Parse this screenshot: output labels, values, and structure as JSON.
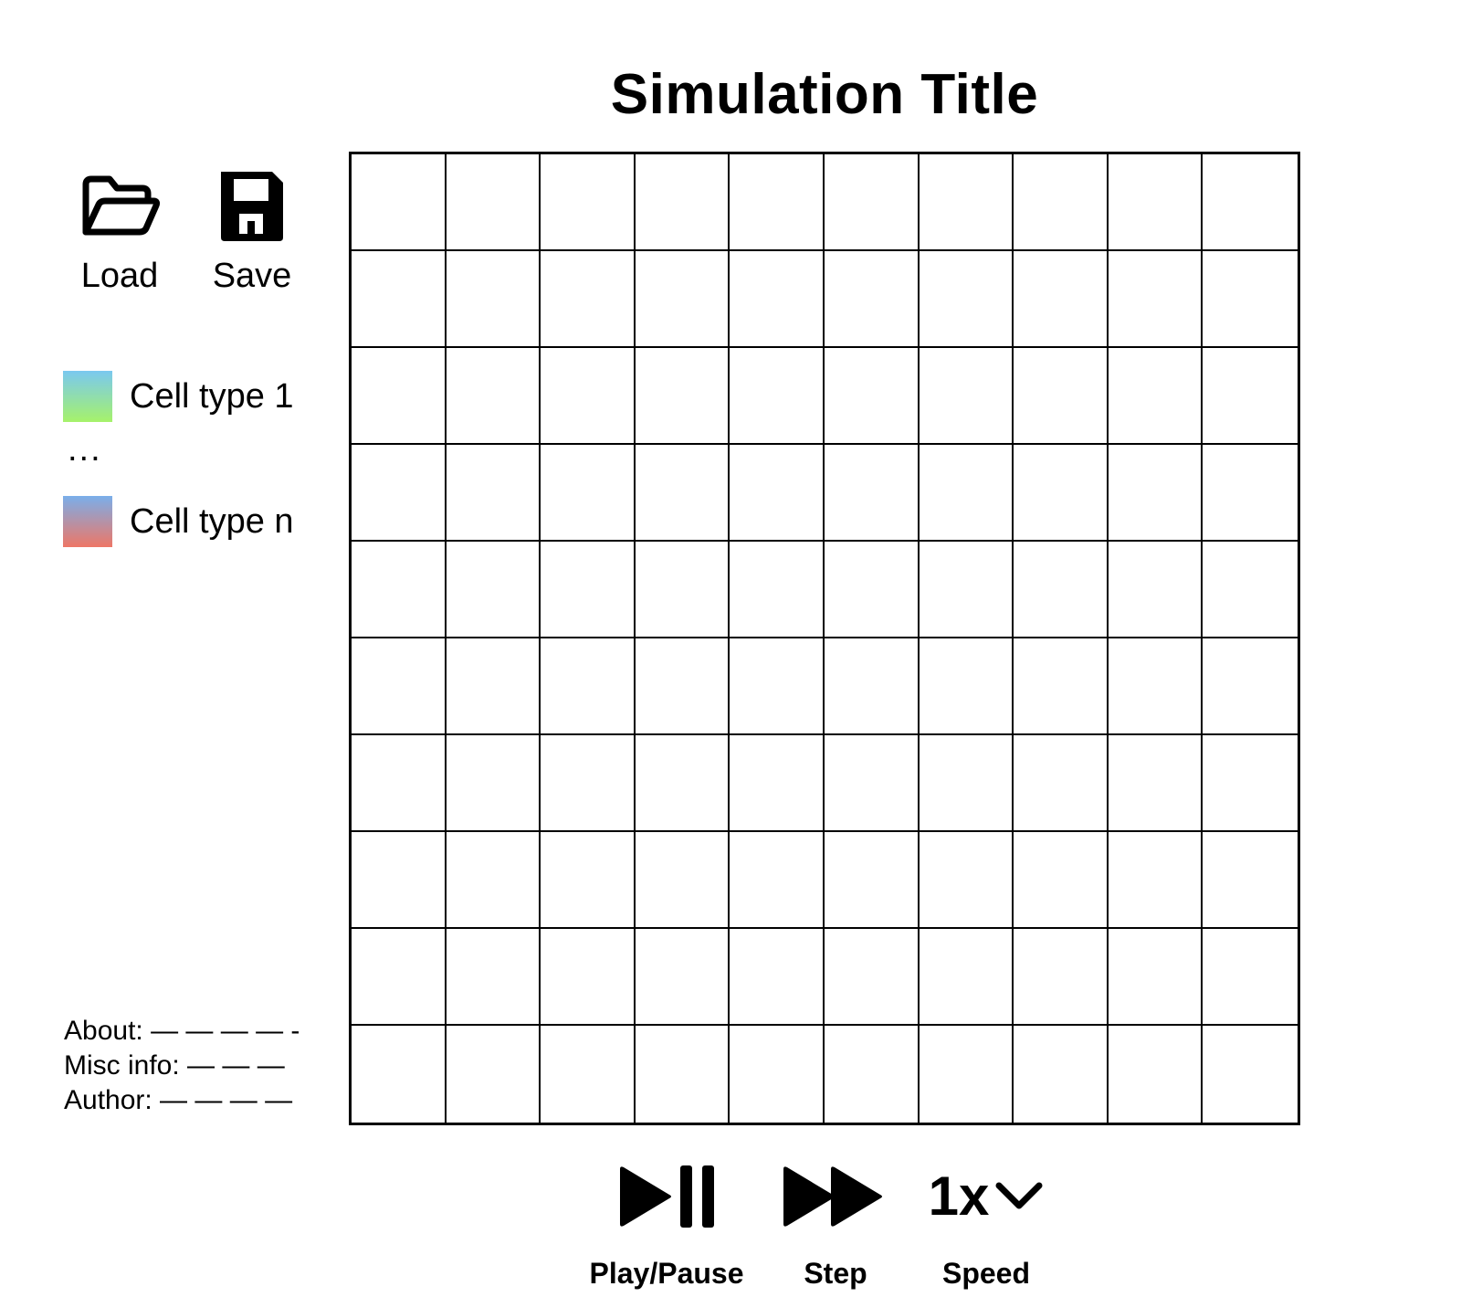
{
  "title": "Simulation Title",
  "toolbar": {
    "load": {
      "label": "Load",
      "icon": "folder-open-icon"
    },
    "save": {
      "label": "Save",
      "icon": "floppy-disk-icon"
    }
  },
  "legend": {
    "items": [
      {
        "label": "Cell type 1",
        "gradient": [
          "#7ac8f0",
          "#a6f26a"
        ]
      },
      {
        "label": "Cell type n",
        "gradient": [
          "#7aafea",
          "#ee7766"
        ]
      }
    ],
    "ellipsis": "..."
  },
  "info": {
    "rows": [
      {
        "text": "About: — — — — -"
      },
      {
        "text": "Misc info: — — —"
      },
      {
        "text": "Author: — — — —"
      }
    ]
  },
  "grid": {
    "rows": 10,
    "cols": 10
  },
  "controls": {
    "play_pause": {
      "label": "Play/Pause",
      "icon": "play-pause-icon"
    },
    "step": {
      "label": "Step",
      "icon": "fast-forward-icon"
    },
    "speed": {
      "label": "Speed",
      "value": "1x",
      "icon": "chevron-down-icon"
    }
  }
}
